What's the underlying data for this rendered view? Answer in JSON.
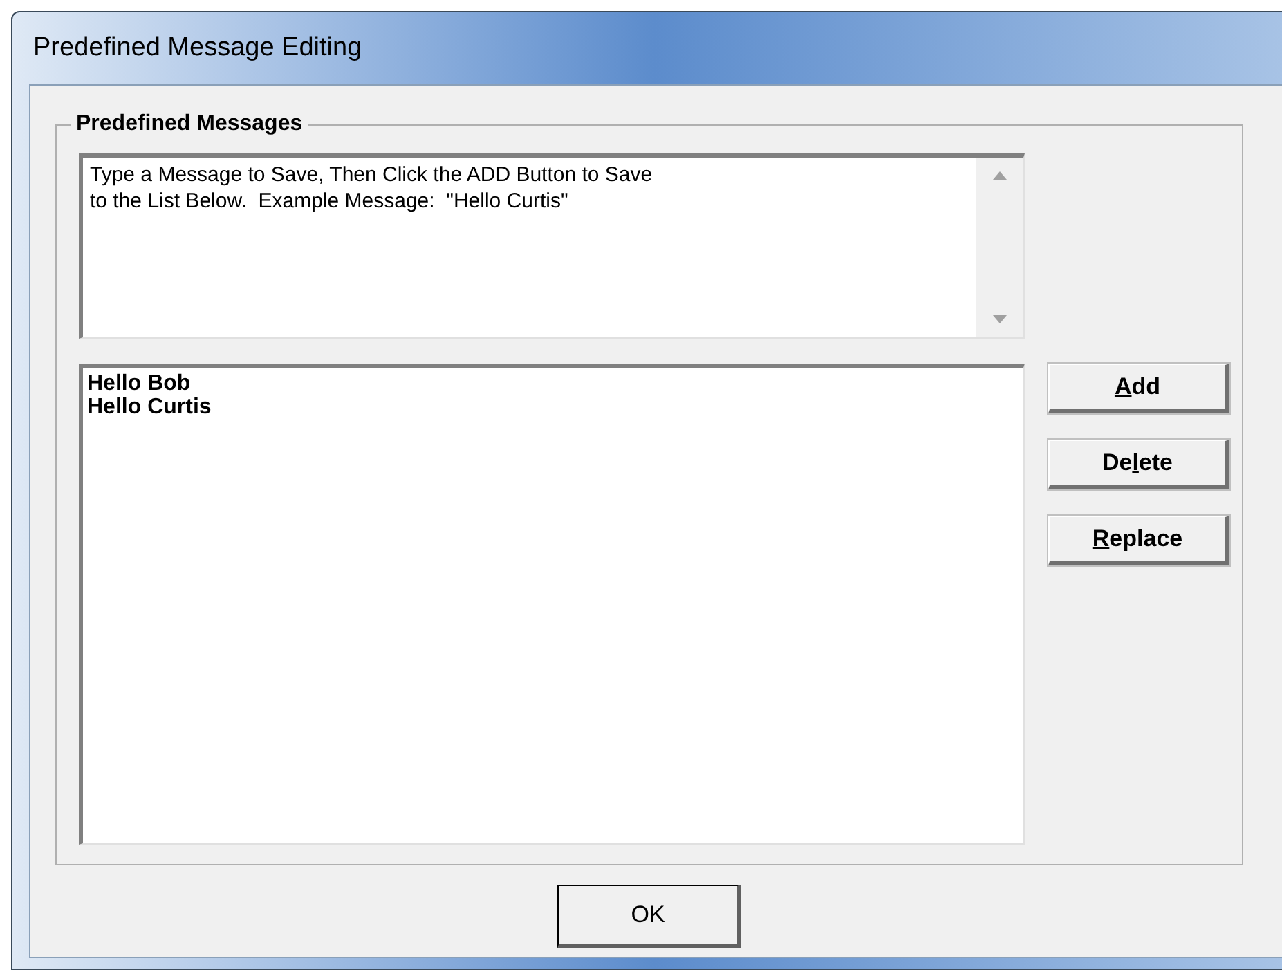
{
  "window": {
    "title": "Predefined Message Editing"
  },
  "group": {
    "title": "Predefined Messages"
  },
  "message_field": {
    "value": "Type a Message to Save, Then Click the ADD Button to Save\nto the List Below.  Example Message:  \"Hello Curtis\""
  },
  "messages": [
    {
      "text": "Hello Bob",
      "selected": false
    },
    {
      "text": "Hello Curtis",
      "selected": false
    }
  ],
  "side_buttons": [
    {
      "access_key": "A",
      "rest": "dd"
    },
    {
      "before": "De",
      "access_key": "l",
      "rest": "ete"
    },
    {
      "access_key": "R",
      "rest": "eplace"
    }
  ],
  "ok_button": {
    "label": "OK"
  }
}
